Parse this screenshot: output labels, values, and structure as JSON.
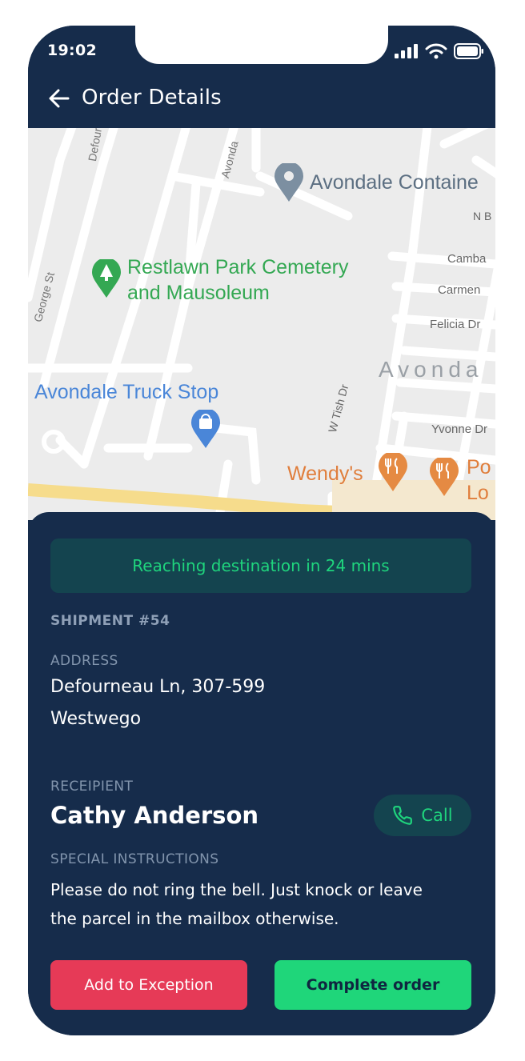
{
  "status_bar": {
    "time": "19:02"
  },
  "header": {
    "title": "Order Details"
  },
  "map": {
    "places": {
      "container": "Avondale Containe",
      "cemetery_line1": "Restlawn Park Cemetery",
      "cemetery_line2": "and Mausoleum",
      "truck_stop": "Avondale Truck Stop",
      "wendys": "Wendy's",
      "popeyes_line1": "Po",
      "popeyes_line2": "Lo",
      "area": "Avonda"
    },
    "streets": {
      "defourneau": "Defourneau",
      "avondale": "Avonda",
      "george": "George St",
      "nb": "N B",
      "camba": "Camba",
      "carmen": "Carmen",
      "felicia": "Felicia Dr",
      "tish": "W Tish Dr",
      "yvonne": "Yvonne Dr"
    },
    "colors": {
      "green_poi": "#34a853",
      "blue_poi": "#4a86d8",
      "orange_poi": "#e58a43",
      "gray_poi": "#7c8fa1"
    }
  },
  "details": {
    "eta": "Reaching destination in 24 mins",
    "shipment": "SHIPMENT #54",
    "address_label": "ADDRESS",
    "address_line1": "Defourneau Ln, 307-599",
    "address_line2": "Westwego",
    "recipient_label": "RECEIPIENT",
    "recipient_name": "Cathy Anderson",
    "call_label": "Call",
    "instructions_label": "SPECIAL INSTRUCTIONS",
    "instructions_line1": "Please do not ring the bell. Just knock or leave",
    "instructions_line2": "the parcel in the mailbox otherwise."
  },
  "actions": {
    "exception": "Add to Exception",
    "complete": "Complete order"
  },
  "theme": {
    "background": "#162c4b",
    "accent": "#1fd47d",
    "danger": "#e63a57"
  }
}
